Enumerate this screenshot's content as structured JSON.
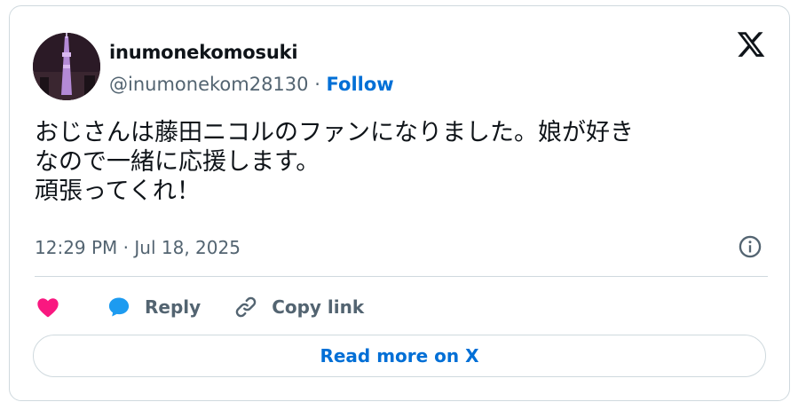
{
  "author": {
    "display_name": "inumonekomosuki",
    "handle": "@inumonekom28130",
    "separator": " · ",
    "follow_label": "Follow"
  },
  "tweet": {
    "lines": [
      "おじさんは藤田ニコルのファンになりました。娘が好き",
      "なので一緒に応援します。",
      "頑張ってくれ！"
    ],
    "timestamp": "12:29 PM · Jul 18, 2025"
  },
  "actions": {
    "reply_label": "Reply",
    "copy_link_label": "Copy link"
  },
  "read_more_label": "Read more on X",
  "colors": {
    "heart": "#f91880",
    "reply_bubble": "#1d9bf0",
    "link_blue": "#006fd6",
    "muted": "#536471",
    "border": "#cfd9de"
  },
  "icons": [
    "avatar",
    "x-logo-icon",
    "info-icon",
    "heart-icon",
    "reply-icon",
    "link-icon"
  ]
}
